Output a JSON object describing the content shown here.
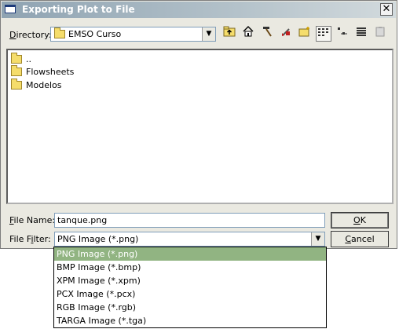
{
  "window": {
    "title": "Exporting Plot to File",
    "close_glyph": "✕"
  },
  "directory": {
    "label_u": "D",
    "label_rest": "irectory:",
    "value": "EMSO Curso"
  },
  "toolbar": {
    "icons": [
      "up-folder-icon",
      "home-icon",
      "hammer-icon",
      "bookmark-icon",
      "new-folder-icon",
      "list-view-icon",
      "details-view-icon",
      "show-hidden-icon",
      "paste-icon"
    ]
  },
  "files": [
    {
      "name": ".."
    },
    {
      "name": "Flowsheets"
    },
    {
      "name": "Modelos"
    }
  ],
  "filename": {
    "label_u": "F",
    "label_rest": "ile Name:",
    "value": "tanque.png"
  },
  "filter": {
    "label_pre": "File F",
    "label_u": "i",
    "label_rest": "lter:",
    "value": "PNG Image (*.png)",
    "options": [
      "PNG Image (*.png)",
      "BMP Image (*.bmp)",
      "XPM Image (*.xpm)",
      "PCX Image (*.pcx)",
      "RGB Image (*.rgb)",
      "TARGA Image (*.tga)"
    ]
  },
  "buttons": {
    "ok_u": "O",
    "ok_rest": "K",
    "cancel_u": "C",
    "cancel_rest": "ancel"
  }
}
